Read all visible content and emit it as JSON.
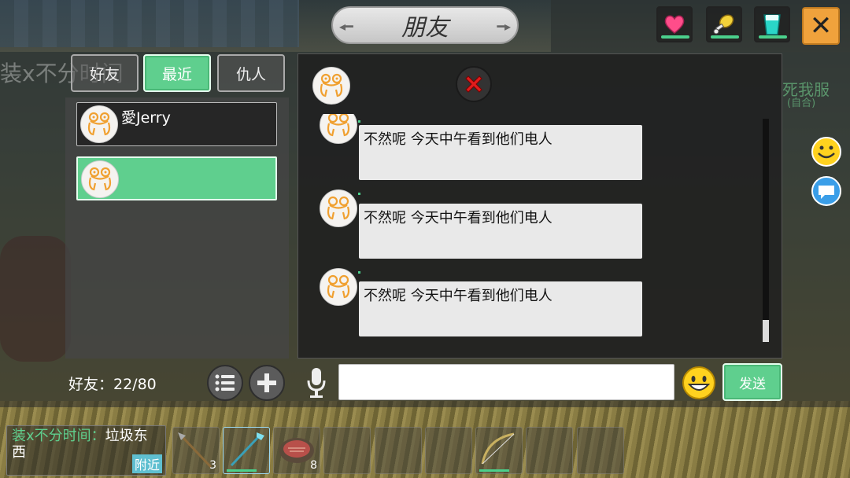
{
  "title": "朋友",
  "tabs": [
    {
      "label": "好友",
      "active": false
    },
    {
      "label": "最近",
      "active": true
    },
    {
      "label": "仇人",
      "active": false
    }
  ],
  "friends": [
    {
      "name": "愛Jerry"
    },
    {
      "name": ""
    }
  ],
  "friend_count": "好友：22/80",
  "messages": [
    {
      "text": "不然呢 今天中午看到他们电人"
    },
    {
      "text": "不然呢 今天中午看到他们电人"
    },
    {
      "text": "不然呢 今天中午看到他们电人"
    }
  ],
  "input": {
    "value": "",
    "placeholder": ""
  },
  "send_label": "发送",
  "background_text": {
    "overlay_left": "装x不分时间",
    "overlay_right": "死我服",
    "overlay_right_sub": "(自合)"
  },
  "nearby_chat": {
    "sender": "装x不分时间",
    "separator": "：",
    "message": "垃圾东西",
    "tag": "附近"
  },
  "hotbar": [
    {
      "item": "spear",
      "qty": "3"
    },
    {
      "item": "crystal-staff",
      "qty": ""
    },
    {
      "item": "meat",
      "qty": "8"
    },
    {
      "item": "",
      "qty": ""
    },
    {
      "item": "",
      "qty": ""
    },
    {
      "item": "",
      "qty": ""
    },
    {
      "item": "bow",
      "qty": ""
    },
    {
      "item": "",
      "qty": ""
    },
    {
      "item": "",
      "qty": ""
    }
  ],
  "colors": {
    "accent_green": "#5fcf8e",
    "close_orange": "#f0a23c",
    "heart": "#ff4d8a",
    "hunger": "#f2d23a",
    "thirst": "#2ad6c8"
  },
  "icons": [
    "heart-icon",
    "drumstick-icon",
    "cup-icon",
    "close-icon",
    "frog-avatar-icon",
    "red-x-icon",
    "list-icon",
    "plus-icon",
    "microphone-icon",
    "smiley-icon",
    "chat-bubble-icon"
  ]
}
